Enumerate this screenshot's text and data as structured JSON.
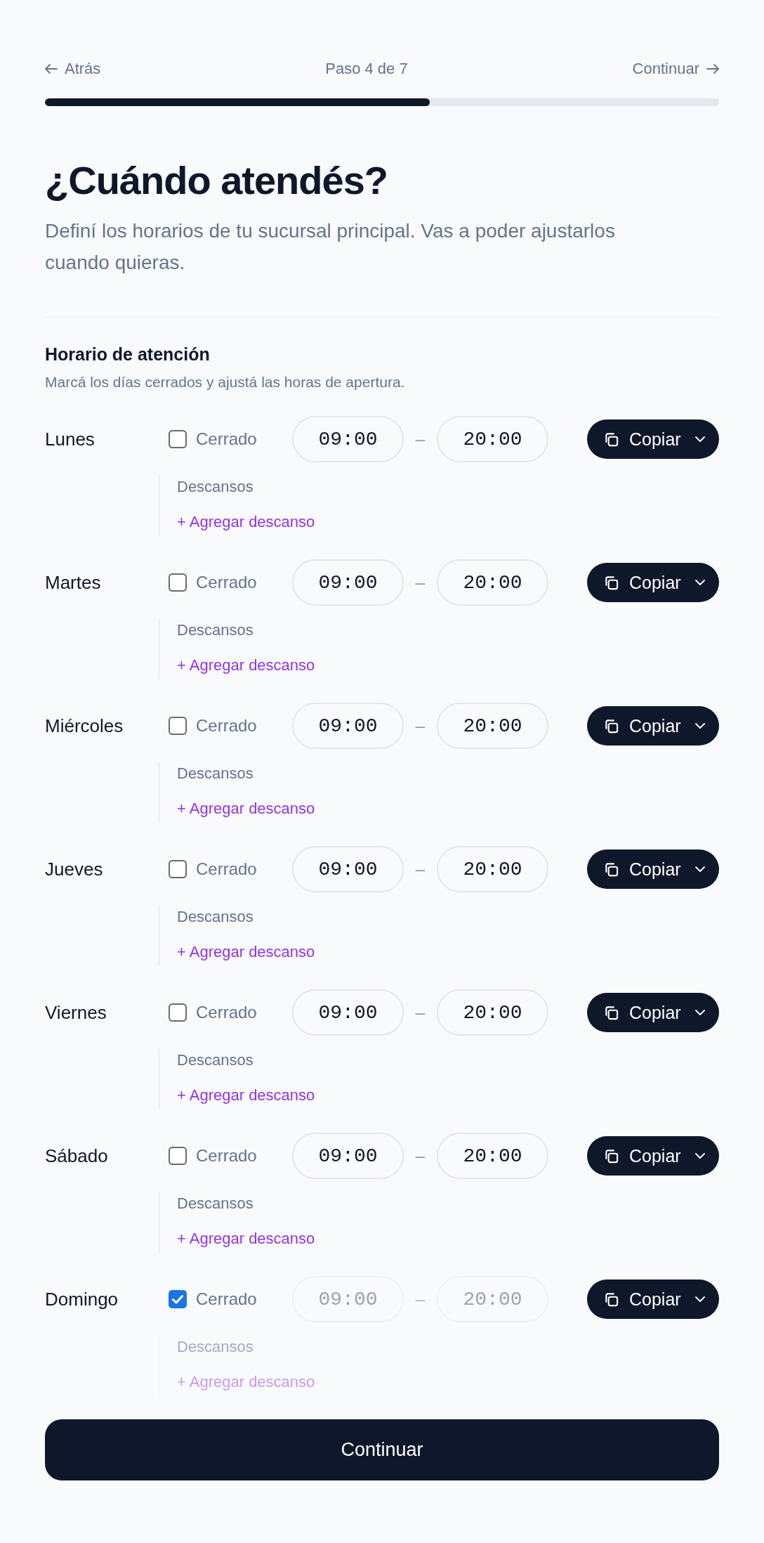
{
  "nav": {
    "back_label": "Atrás",
    "step": "Paso 4 de 7",
    "next_label": "Continuar"
  },
  "progress": {
    "level": 0.571
  },
  "header": {
    "title": "¿Cuándo atendés?",
    "subtitle": "Definí los horarios de tu sucursal principal. Vas a poder ajustarlos cuando quieras."
  },
  "section": {
    "title": "Horario de atención",
    "description": "Marcá los días cerrados y ajustá las horas de apertura."
  },
  "days": [
    {
      "name": "Lunes",
      "closed_label": "Cerrado",
      "closed": false,
      "open": "09:00",
      "separator": "–",
      "close": "20:00",
      "copy_label": "Copiar",
      "breaks_label": "Descansos",
      "add_break_label": "+ Agregar descanso"
    },
    {
      "name": "Martes",
      "closed_label": "Cerrado",
      "closed": false,
      "open": "09:00",
      "separator": "–",
      "close": "20:00",
      "copy_label": "Copiar",
      "breaks_label": "Descansos",
      "add_break_label": "+ Agregar descanso"
    },
    {
      "name": "Miércoles",
      "closed_label": "Cerrado",
      "closed": false,
      "open": "09:00",
      "separator": "–",
      "close": "20:00",
      "copy_label": "Copiar",
      "breaks_label": "Descansos",
      "add_break_label": "+ Agregar descanso"
    },
    {
      "name": "Jueves",
      "closed_label": "Cerrado",
      "closed": false,
      "open": "09:00",
      "separator": "–",
      "close": "20:00",
      "copy_label": "Copiar",
      "breaks_label": "Descansos",
      "add_break_label": "+ Agregar descanso"
    },
    {
      "name": "Viernes",
      "closed_label": "Cerrado",
      "closed": false,
      "open": "09:00",
      "separator": "–",
      "close": "20:00",
      "copy_label": "Copiar",
      "breaks_label": "Descansos",
      "add_break_label": "+ Agregar descanso"
    },
    {
      "name": "Sábado",
      "closed_label": "Cerrado",
      "closed": false,
      "open": "09:00",
      "separator": "–",
      "close": "20:00",
      "copy_label": "Copiar",
      "breaks_label": "Descansos",
      "add_break_label": "+ Agregar descanso"
    },
    {
      "name": "Domingo",
      "closed_label": "Cerrado",
      "closed": true,
      "open": "09:00",
      "separator": "–",
      "close": "20:00",
      "copy_label": "Copiar",
      "breaks_label": "Descansos",
      "add_break_label": "+ Agregar descanso"
    }
  ],
  "submit": {
    "label": "Continuar"
  }
}
